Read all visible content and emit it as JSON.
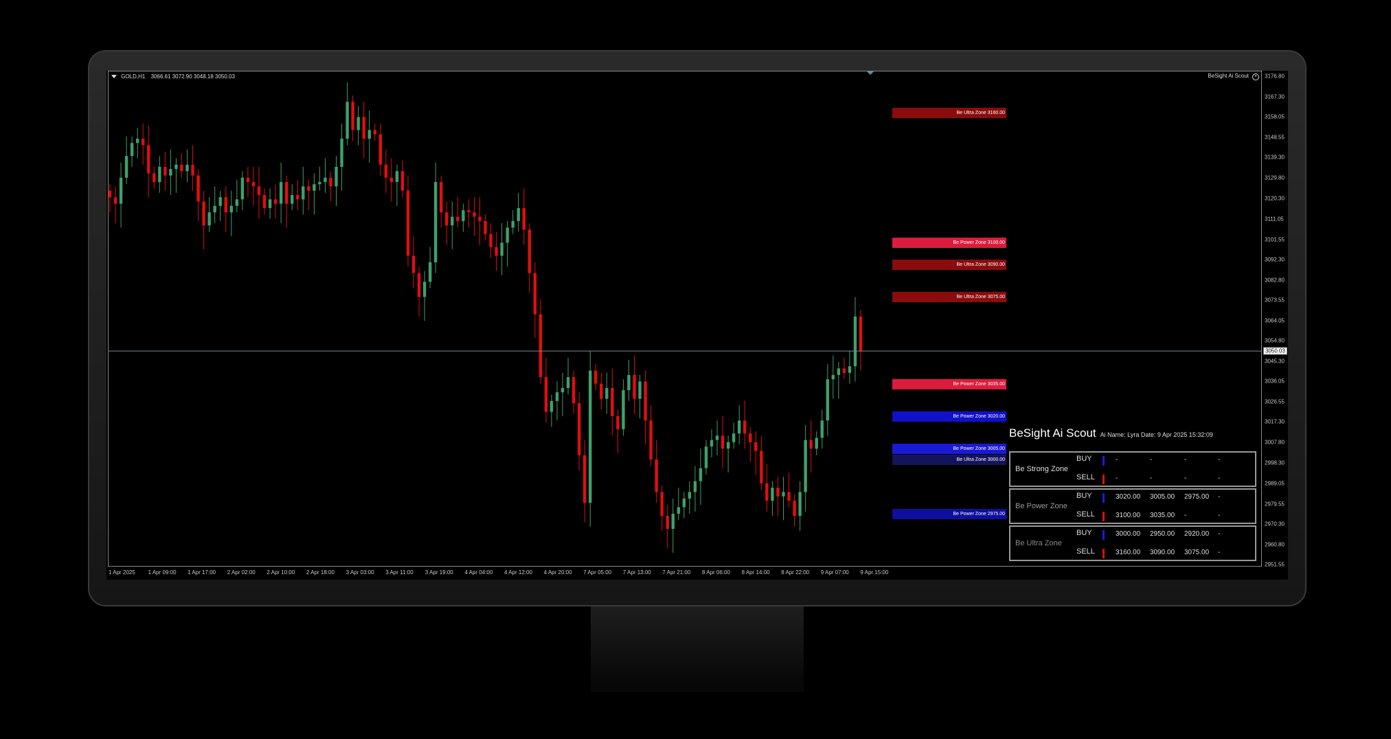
{
  "chart": {
    "symbol": "GOLD,H1",
    "ohlc": "3066.61 3072.90 3048.18 3050.03",
    "indicator": "BeSight Ai Scout",
    "current_price": "3050.03",
    "price_ticks": [
      "3176.80",
      "3167.30",
      "3158.05",
      "3148.55",
      "3139.30",
      "3129.80",
      "3120.30",
      "3111.05",
      "3101.55",
      "3092.30",
      "3082.80",
      "3073.55",
      "3064.05",
      "3054.80",
      "3045.30",
      "3036.05",
      "3026.55",
      "3017.30",
      "3007.80",
      "2998.30",
      "2989.05",
      "2979.55",
      "2970.30",
      "2960.80",
      "2951.55"
    ],
    "time_ticks": [
      "1 Apr 2025",
      "1 Apr 09:00",
      "1 Apr 17:00",
      "2 Apr 02:00",
      "2 Apr 10:00",
      "2 Apr 18:00",
      "3 Apr 03:00",
      "3 Apr 11:00",
      "3 Apr 19:00",
      "4 Apr 04:00",
      "4 Apr 12:00",
      "4 Apr 20:00",
      "7 Apr 05:00",
      "7 Apr 13:00",
      "7 Apr 21:00",
      "8 Apr 06:00",
      "8 Apr 14:00",
      "8 Apr 22:00",
      "9 Apr 07:00",
      "9 Apr 15:00"
    ],
    "colors": {
      "bull": "#3fa06b",
      "bear": "#e00f0f",
      "grid_line": "#7d8aa0"
    }
  },
  "zones": [
    {
      "label": "Be Ultra Zone 3160.00",
      "price": 3160.0,
      "color": "#8a0c0c"
    },
    {
      "label": "Be Power Zone 3100.00",
      "price": 3100.0,
      "color": "#dc1c3c"
    },
    {
      "label": "Be Ultra Zone 3090.00",
      "price": 3090.0,
      "color": "#8a0c0c"
    },
    {
      "label": "Be Ultra Zone 3075.00",
      "price": 3075.0,
      "color": "#8a0c0c"
    },
    {
      "label": "Be Power Zone 3035.00",
      "price": 3035.0,
      "color": "#dc1c3c"
    },
    {
      "label": "Be Power Zone 3020.00",
      "price": 3020.0,
      "color": "#1010c8"
    },
    {
      "label": "Be Power Zone 3005.00",
      "price": 3005.0,
      "color": "#1a1ad2"
    },
    {
      "label": "Be Ultra Zone 3000.00",
      "price": 3000.0,
      "color": "#14145e"
    },
    {
      "label": "Be Power Zone 2975.00",
      "price": 2975.0,
      "color": "#0e0ea0"
    }
  ],
  "panel": {
    "title": "BeSight Ai Scout",
    "subtitle": "Ai Name: Lyra Date: 9 Apr 2025 15:32:09",
    "buy_label": "BUY",
    "sell_label": "SELL",
    "boxes": [
      {
        "name": "Be Strong Zone",
        "name_color": "#dddddd",
        "buy": [
          "-",
          "-",
          "-",
          "-"
        ],
        "sell": [
          "-",
          "-",
          "-",
          "-"
        ]
      },
      {
        "name": "Be Power Zone",
        "name_color": "#9a9a9a",
        "buy": [
          "3020.00",
          "3005.00",
          "2975.00",
          "-"
        ],
        "sell": [
          "3100.00",
          "3035.00",
          "-",
          "-"
        ]
      },
      {
        "name": "Be Ultra Zone",
        "name_color": "#8a8a8a",
        "buy": [
          "3000.00",
          "2950.00",
          "2920.00",
          "-"
        ],
        "sell": [
          "3160.00",
          "3090.00",
          "3075.00",
          "-"
        ]
      }
    ],
    "buy_color": "#1a1ae0",
    "sell_color": "#e00f0f"
  },
  "chart_data": {
    "type": "candlestick",
    "title": "GOLD,H1",
    "xlabel": "",
    "ylabel": "",
    "ylim": [
      2951.55,
      3176.8
    ],
    "close": [
      3121,
      3118,
      3130,
      3140,
      3146,
      3148,
      3145,
      3132,
      3128,
      3135,
      3131,
      3134,
      3136,
      3133,
      3136,
      3131,
      3119,
      3108,
      3114,
      3117,
      3121,
      3114,
      3117,
      3120,
      3130,
      3128,
      3126,
      3122,
      3116,
      3120,
      3118,
      3128,
      3118,
      3122,
      3120,
      3126,
      3124,
      3127,
      3128,
      3130,
      3126,
      3135,
      3148,
      3165,
      3152,
      3158,
      3148,
      3152,
      3150,
      3136,
      3130,
      3128,
      3133,
      3124,
      3094,
      3086,
      3075,
      3082,
      3091,
      3128,
      3114,
      3108,
      3112,
      3110,
      3115,
      3114,
      3112,
      3110,
      3104,
      3098,
      3094,
      3100,
      3107,
      3110,
      3116,
      3106,
      3086,
      3067,
      3038,
      3022,
      3027,
      3031,
      3033,
      3038,
      3026,
      3002,
      2980,
      3041,
      3035,
      3028,
      3033,
      3020,
      3014,
      3032,
      3039,
      3028,
      3036,
      3018,
      3000,
      2985,
      2974,
      2968,
      2975,
      2978,
      2982,
      2985,
      2990,
      2996,
      3006,
      3009,
      3011,
      3005,
      3008,
      3012,
      3018,
      3012,
      3008,
      3004,
      2989,
      2981,
      2987,
      2983,
      2985,
      2981,
      2974,
      2985,
      3009,
      3005,
      3010,
      3018,
      3037,
      3039,
      3042,
      3040,
      3043,
      3066,
      3050
    ]
  }
}
